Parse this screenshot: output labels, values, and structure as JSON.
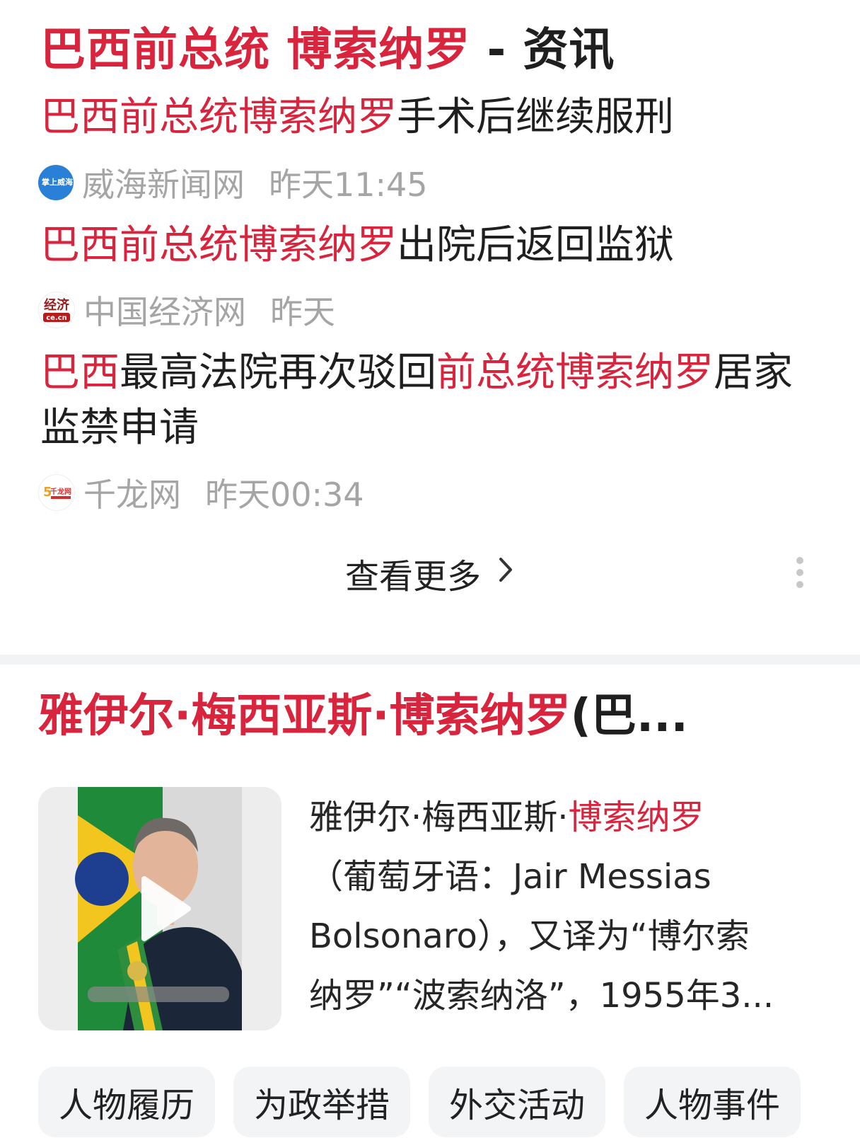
{
  "news": {
    "title_highlight": "巴西前总统 博索纳罗",
    "title_suffix": "- 资讯",
    "items": [
      {
        "headline_parts": [
          {
            "text": "巴西前总统博索纳罗",
            "hl": true
          },
          {
            "text": "手术后继续服刑",
            "hl": false
          }
        ],
        "source": "威海新闻网",
        "time": "昨天11:45",
        "icon": "weihai-news-logo-icon",
        "icon_text": "掌上威海",
        "icon_color": "#2a7fd6"
      },
      {
        "headline_parts": [
          {
            "text": "巴西前总统博索纳罗",
            "hl": true
          },
          {
            "text": "出院后返回监狱",
            "hl": false
          }
        ],
        "source": "中国经济网",
        "time": "昨天",
        "icon": "ce-cn-logo-icon",
        "icon_text": "经济 ce.cn",
        "icon_color": "#b71c1c"
      },
      {
        "headline_parts": [
          {
            "text": "巴西",
            "hl": true
          },
          {
            "text": "最高法院再次驳回",
            "hl": false
          },
          {
            "text": "前总统博索纳罗",
            "hl": true
          },
          {
            "text": "居家监禁申请",
            "hl": false
          }
        ],
        "source": "千龙网",
        "time": "昨天00:34",
        "icon": "qianlong-logo-icon",
        "icon_text": "千龙网",
        "icon_color": "#d32f2f"
      }
    ],
    "more_label": "查看更多",
    "more_icon": "chevron-right-icon",
    "overflow_icon": "vertical-dots-icon"
  },
  "person": {
    "title_highlight": "雅伊尔·梅西亚斯·博索纳罗",
    "title_rest": "(巴...",
    "desc_line1_plain": "雅伊尔·梅西亚斯·",
    "desc_line1_hl": "博索纳罗",
    "desc_line2": "（葡萄牙语：Jair Messias",
    "desc_line3": "Bolsonaro），又译为“博尔索",
    "desc_line4": "纳罗”“波索纳洛”，1955年3...",
    "thumbnail_icon": "play-icon",
    "tags": [
      "人物履历",
      "为政举措",
      "外交活动",
      "人物事件"
    ]
  },
  "colors": {
    "highlight": "#d8243c",
    "meta_gray": "#a5a5a5",
    "separator": "#f2f3f5",
    "tag_bg": "#f3f4f6"
  }
}
